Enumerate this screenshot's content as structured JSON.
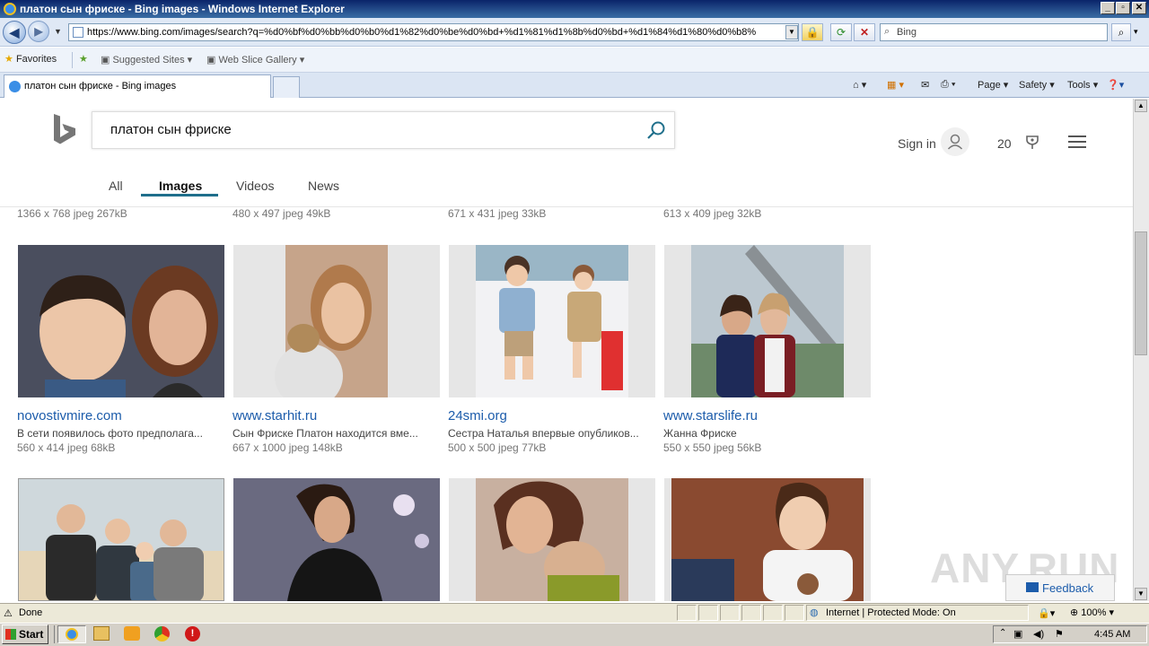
{
  "window": {
    "title": "платон сын фриске - Bing images - Windows Internet Explorer"
  },
  "addressbar": {
    "url": "https://www.bing.com/images/search?q=%d0%bf%d0%bb%d0%b0%d1%82%d0%be%d0%bd+%d1%81%d1%8b%d0%bd+%d1%84%d1%80%d0%b8%"
  },
  "search_box": {
    "value": "Bing"
  },
  "favorites_bar": {
    "favorites_label": "Favorites",
    "suggested_sites": "Suggested Sites",
    "web_slice_gallery": "Web Slice Gallery"
  },
  "tabs": {
    "active_tab": "платон сын фриске - Bing images"
  },
  "command_bar": {
    "page": "Page",
    "safety": "Safety",
    "tools": "Tools"
  },
  "bing": {
    "query": "платон сын фриске",
    "sign_in": "Sign in",
    "points": "20",
    "nav_tabs": [
      "All",
      "Images",
      "Videos",
      "News"
    ],
    "feedback": "Feedback"
  },
  "previous_row_meta": [
    "1366 x 768 jpeg 267kB",
    "480 x 497 jpeg 49kB",
    "671 x 431 jpeg 33kB",
    "613 x 409 jpeg 32kB"
  ],
  "results": [
    {
      "domain": "novostivmire.com",
      "desc": "В сети появилось фото предполага...",
      "meta": "560 x 414 jpeg 68kB"
    },
    {
      "domain": "www.starhit.ru",
      "desc": "Сын Фриске Платон находится вме...",
      "meta": "667 x 1000 jpeg 148kB"
    },
    {
      "domain": "24smi.org",
      "desc": "Сестра Наталья впервые опубликов...",
      "meta": "500 x 500 jpeg 77kB"
    },
    {
      "domain": "www.starslife.ru",
      "desc": "Жанна Фриске",
      "meta": "550 x 550 jpeg 56kB"
    }
  ],
  "statusbar": {
    "status": "Done",
    "zone": "Internet | Protected Mode: On",
    "zoom": "100%"
  },
  "taskbar": {
    "start": "Start",
    "clock": "4:45 AM"
  },
  "watermark": "ANY.RUN",
  "colors": {
    "link": "#1c5cab",
    "accent": "#1f6f8b"
  }
}
